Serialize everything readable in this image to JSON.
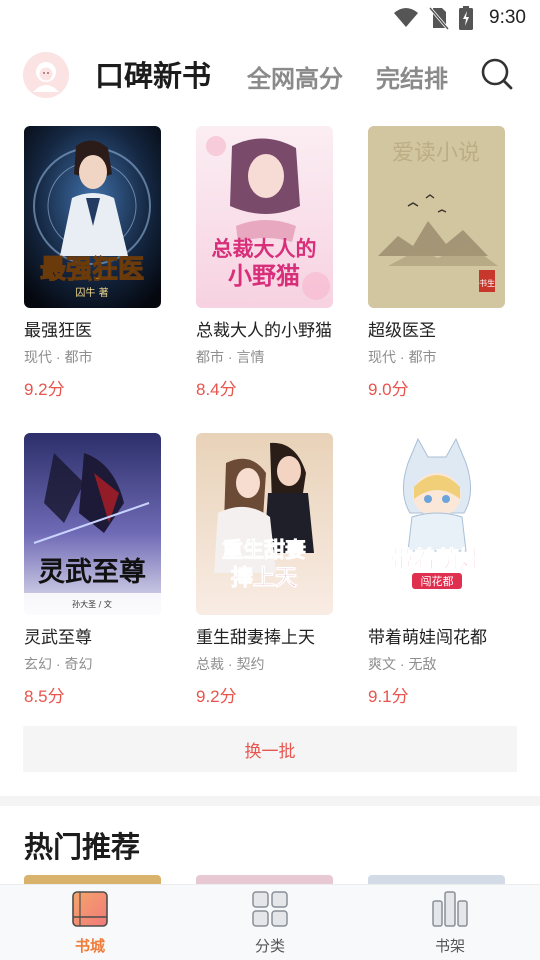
{
  "status": {
    "time": "9:30",
    "icons": [
      "wifi-icon",
      "no-sim-icon",
      "battery-charging-icon"
    ]
  },
  "header": {
    "tabs": [
      {
        "label": "口碑新书",
        "active": true
      },
      {
        "label": "全网高分",
        "active": false
      },
      {
        "label": "完结排",
        "active": false
      }
    ],
    "icons": [
      "avatar",
      "search-icon"
    ]
  },
  "books": [
    {
      "title": "最强狂医",
      "tags": "现代 · 都市",
      "score": "9.2分",
      "cover_text": "最强狂医",
      "cover_author": "囚牛 著"
    },
    {
      "title": "总裁大人的小野猫",
      "tags": "都市 · 言情",
      "score": "8.4分",
      "cover_text": "总裁大人的小野猫"
    },
    {
      "title": "超级医圣",
      "tags": "现代 · 都市",
      "score": "9.0分",
      "cover_text": "爱读小说",
      "cover_seal": "书生"
    },
    {
      "title": "灵武至尊",
      "tags": "玄幻 · 奇幻",
      "score": "8.5分",
      "cover_text": "灵武至尊",
      "cover_author": "孙大圣 / 文"
    },
    {
      "title": "重生甜妻捧上天",
      "tags": "总裁 · 契约",
      "score": "9.2分",
      "cover_text": "重生甜妻捧上天"
    },
    {
      "title": "带着萌娃闯花都",
      "tags": "爽文 · 无敌",
      "score": "9.1分",
      "cover_text": "带着萌娃闯花都"
    }
  ],
  "refresh_label": "换一批",
  "section_title": "热门推荐",
  "bottom_nav": [
    {
      "label": "书城",
      "active": true,
      "icon": "bookstore-icon"
    },
    {
      "label": "分类",
      "active": false,
      "icon": "category-grid-icon"
    },
    {
      "label": "书架",
      "active": false,
      "icon": "bookshelf-icon"
    }
  ],
  "colors": {
    "accent": "#e8554e",
    "nav_active": "#ef7d3a",
    "muted": "#8e8e8e"
  }
}
